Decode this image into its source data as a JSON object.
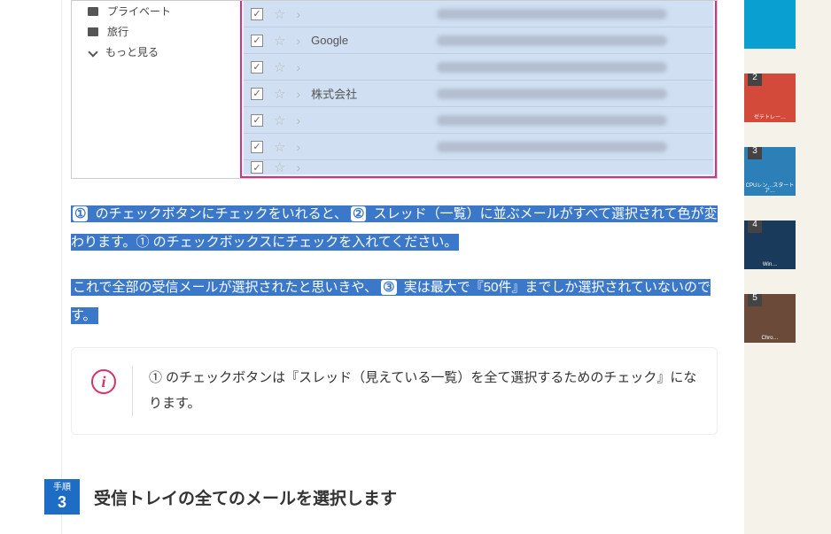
{
  "screenshot": {
    "nav": {
      "private": "プライベート",
      "travel": "旅行",
      "more": "もっと見る"
    },
    "rows": [
      {
        "sender": ""
      },
      {
        "sender": "Google"
      },
      {
        "sender": ""
      },
      {
        "sender": "株式会社"
      },
      {
        "sender": ""
      },
      {
        "sender": ""
      },
      {
        "sender": ""
      }
    ]
  },
  "para1": {
    "c1": "①",
    "t1": " のチェックボタンにチェックをいれると、",
    "c2": "②",
    "t2": " スレッド（一覧）に並ぶメールがすべて選択されて色が変わります。① のチェックボックスにチェックを入れてください。"
  },
  "para2": {
    "t1": "これで全部の受信メールが選択されたと思いきや、",
    "c3": "③",
    "t2": " 実は最大で『50件』までしか選択されていないのです。"
  },
  "info": {
    "text": "① のチェックボタンは『スレッド（見えている一覧）を全て選択するためのチェック』になります。"
  },
  "step": {
    "label": "手順",
    "num": "3",
    "title": "受信トレイの全てのメールを選択します"
  },
  "sidebar": {
    "items": [
      {
        "rank": "",
        "caption": ""
      },
      {
        "rank": "2",
        "caption": "ゼテトレー…"
      },
      {
        "rank": "3",
        "caption": "CPUレン…スタートア…"
      },
      {
        "rank": "4",
        "caption": "Win…"
      },
      {
        "rank": "5",
        "caption": "Chro…"
      }
    ]
  }
}
